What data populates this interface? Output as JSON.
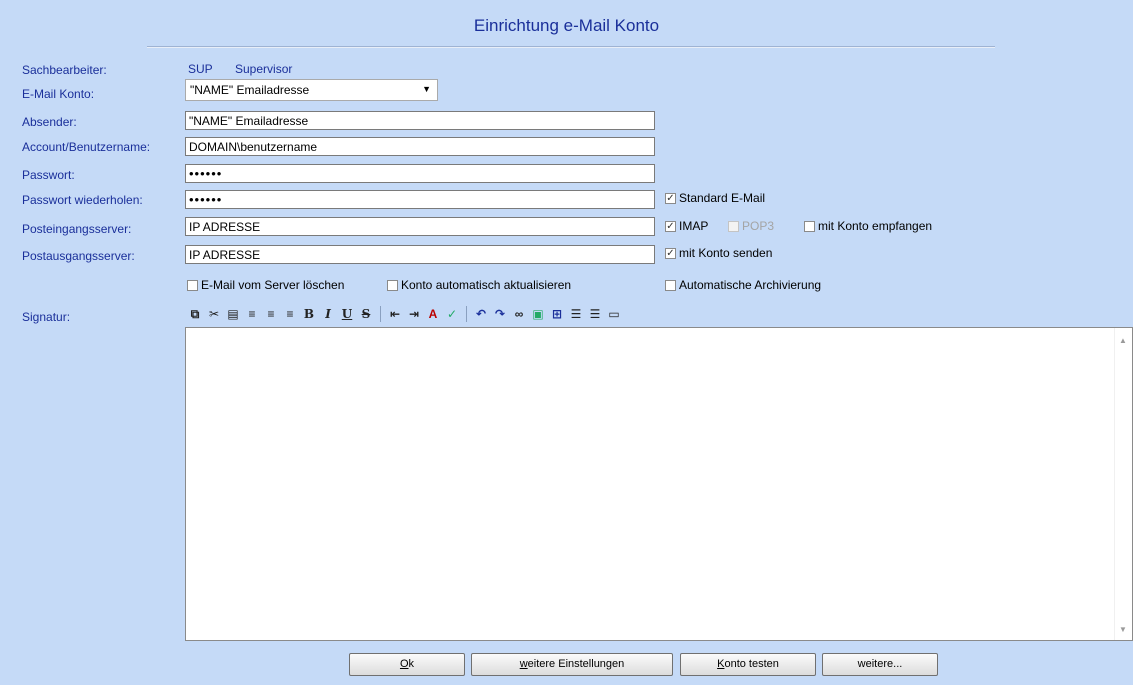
{
  "window": {
    "title": "Einrichtung e-Mail Konto"
  },
  "form": {
    "sachbearbeiter": {
      "label": "Sachbearbeiter:",
      "code": "SUP",
      "name": "Supervisor"
    },
    "email_konto": {
      "label": "E-Mail Konto:",
      "value": "\"NAME\" Emailadresse"
    },
    "absender": {
      "label": "Absender:",
      "value": "\"NAME\" Emailadresse"
    },
    "account": {
      "label": "Account/Benutzername:",
      "value": "DOMAIN\\benutzername"
    },
    "passwort": {
      "label": "Passwort:",
      "value": "••••••"
    },
    "passwort_wiederholen": {
      "label": "Passwort wiederholen:",
      "value": "••••••"
    },
    "posteingang": {
      "label": "Posteingangsserver:",
      "value": "IP ADRESSE"
    },
    "postausgang": {
      "label": "Postausgangsserver:",
      "value": "IP ADRESSE"
    },
    "signatur": {
      "label": "Signatur:"
    }
  },
  "checkboxes": {
    "standard_email": {
      "label": "Standard E-Mail",
      "checked": true
    },
    "imap": {
      "label": "IMAP",
      "checked": true
    },
    "pop3": {
      "label": "POP3",
      "checked": false,
      "disabled": true
    },
    "mit_konto_empfangen": {
      "label": "mit Konto empfangen",
      "checked": false
    },
    "mit_konto_senden": {
      "label": "mit Konto senden",
      "checked": true
    },
    "email_loeschen": {
      "label": "E-Mail vom Server löschen",
      "checked": false
    },
    "konto_aktualisieren": {
      "label": "Konto automatisch aktualisieren",
      "checked": false
    },
    "archivierung": {
      "label": "Automatische Archivierung",
      "checked": false
    }
  },
  "toolbar_icons": [
    "copy-icon",
    "cut-icon",
    "paste-icon",
    "align-left-icon",
    "align-center-icon",
    "align-right-icon",
    "bold-icon",
    "italic-icon",
    "underline-icon",
    "strikethrough-icon",
    "outdent-icon",
    "indent-icon",
    "text-color-icon",
    "spellcheck-icon",
    "undo-icon",
    "redo-icon",
    "link-icon",
    "image-icon",
    "table-icon",
    "numbered-list-icon",
    "bullet-list-icon",
    "horizontal-rule-icon"
  ],
  "buttons": {
    "ok": {
      "mnemonic": "O",
      "rest": "k"
    },
    "weitere_einstellungen": {
      "mnemonic": "w",
      "rest": "eitere Einstellungen"
    },
    "konto_testen": {
      "mnemonic": "K",
      "rest": "onto testen"
    },
    "weitere": {
      "label": "weitere..."
    }
  },
  "colors": {
    "background": "#c5daf7",
    "label": "#1a2f9a"
  }
}
